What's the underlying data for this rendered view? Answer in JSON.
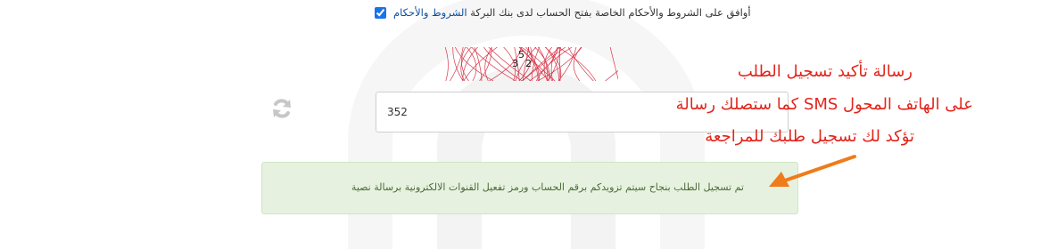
{
  "terms": {
    "checked": true,
    "text": "أوافق على الشروط والأحكام الخاصة بفتح الحساب لدى بنك البركة",
    "link_text": "الشروط والأحكام"
  },
  "captcha": {
    "digits": [
      "5",
      "3",
      "2"
    ],
    "stroke_color": "#d9364a"
  },
  "code_field": {
    "value": "352"
  },
  "annotation": {
    "line1": "رسالة تأكيد تسجيل الطلب",
    "line2": "على الهاتف المحول SMS كما ستصلك رسالة",
    "line3": "تؤكد لك تسجيل طلبك للمراجعة",
    "color": "#e3241b"
  },
  "alert": {
    "text": "تم تسجيل الطلب بنجاح سيتم تزويدكم برقم الحساب ورمز تفعيل القنوات الالكترونية برسالة نصية"
  },
  "arrow": {
    "color": "#f07b1a"
  },
  "icons": {
    "refresh": "refresh-icon",
    "arrow": "arrow-left-down-icon"
  }
}
